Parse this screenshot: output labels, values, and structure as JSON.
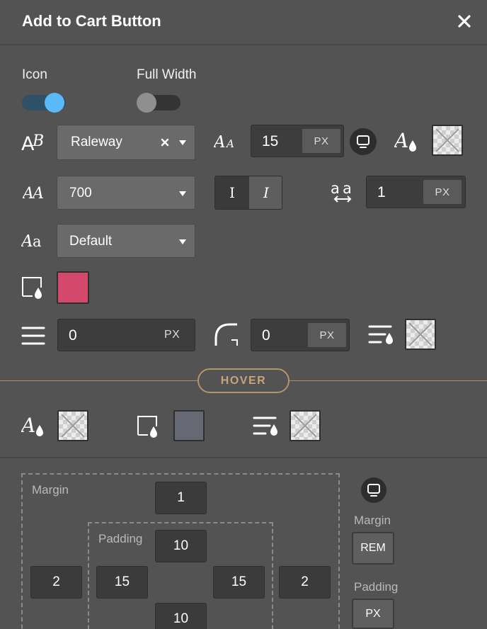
{
  "header": {
    "title": "Add to Cart Button"
  },
  "icon_toggle": {
    "label": "Icon",
    "on": true
  },
  "full_width_toggle": {
    "label": "Full Width",
    "on": false
  },
  "font_family": {
    "value": "Raleway"
  },
  "font_size": {
    "value": "15",
    "unit": "PX"
  },
  "font_weight": {
    "value": "700"
  },
  "font_style": {
    "normal_label": "I",
    "italic_label": "I"
  },
  "letter_spacing": {
    "value": "1",
    "unit": "PX"
  },
  "text_transform": {
    "value": "Default"
  },
  "background_color": "#d4486b",
  "line_height": {
    "value": "0",
    "unit": "PX"
  },
  "border_radius": {
    "value": "0",
    "unit": "PX"
  },
  "hover": {
    "label": "HOVER",
    "background_color": "#666873"
  },
  "spacing": {
    "margin_label": "Margin",
    "padding_label": "Padding",
    "margin": {
      "top": "1",
      "right": "2",
      "left": "2"
    },
    "padding": {
      "top": "10",
      "right": "15",
      "bottom": "10",
      "left": "15"
    },
    "units": {
      "margin_label": "Margin",
      "margin_unit": "REM",
      "padding_label": "Padding",
      "padding_unit": "PX"
    }
  }
}
